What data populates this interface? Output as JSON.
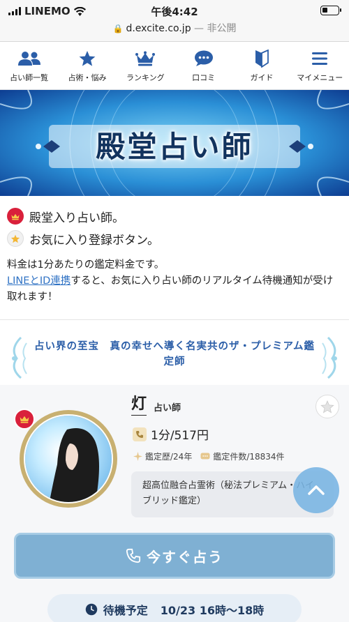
{
  "status_bar": {
    "carrier": "LINEMO",
    "time": "午後4:42"
  },
  "url_bar": {
    "domain": "d.excite.co.jp",
    "privacy": "— 非公開"
  },
  "nav": {
    "items": [
      {
        "label": "占い師一覧",
        "icon": "users-icon"
      },
      {
        "label": "占術・悩み",
        "icon": "star-icon"
      },
      {
        "label": "ランキング",
        "icon": "crown-icon"
      },
      {
        "label": "口コミ",
        "icon": "chat-bubble-icon"
      },
      {
        "label": "ガイド",
        "icon": "beginner-mark-icon"
      },
      {
        "label": "マイメニュー",
        "icon": "hamburger-menu-icon"
      }
    ]
  },
  "banner": {
    "title": "殿堂占い師"
  },
  "legend": {
    "hall_of_fame": "殿堂入り占い師。",
    "favorite": "お気に入り登録ボタン。",
    "pricing_note": "料金は1分あたりの鑑定料金です。",
    "link_text": "LINEとID連携",
    "link_suffix": "すると、お気に入り占い師のリアルタイム待機通知が受け取れます！"
  },
  "premium": {
    "tagline": "占い界の至宝　真の幸せへ導く名実共のザ・プレミアム鑑定師"
  },
  "fortune_teller": {
    "name": "灯",
    "role": "占い師",
    "price": "1分/517円",
    "experience": "鑑定歴/24年",
    "count": "鑑定件数/18834件",
    "description": "超高位融合占霊術（秘法プレミアム・ハイブリッド鑑定）",
    "cta": "今すぐ占う",
    "schedule_label": "待機予定",
    "schedule_value": "10/23 16時～18時"
  },
  "colors": {
    "accent_blue": "#2b5ea8",
    "crown_red": "#d9203b",
    "cta_blue": "#7fb0d3",
    "link_blue": "#2f72c4"
  }
}
